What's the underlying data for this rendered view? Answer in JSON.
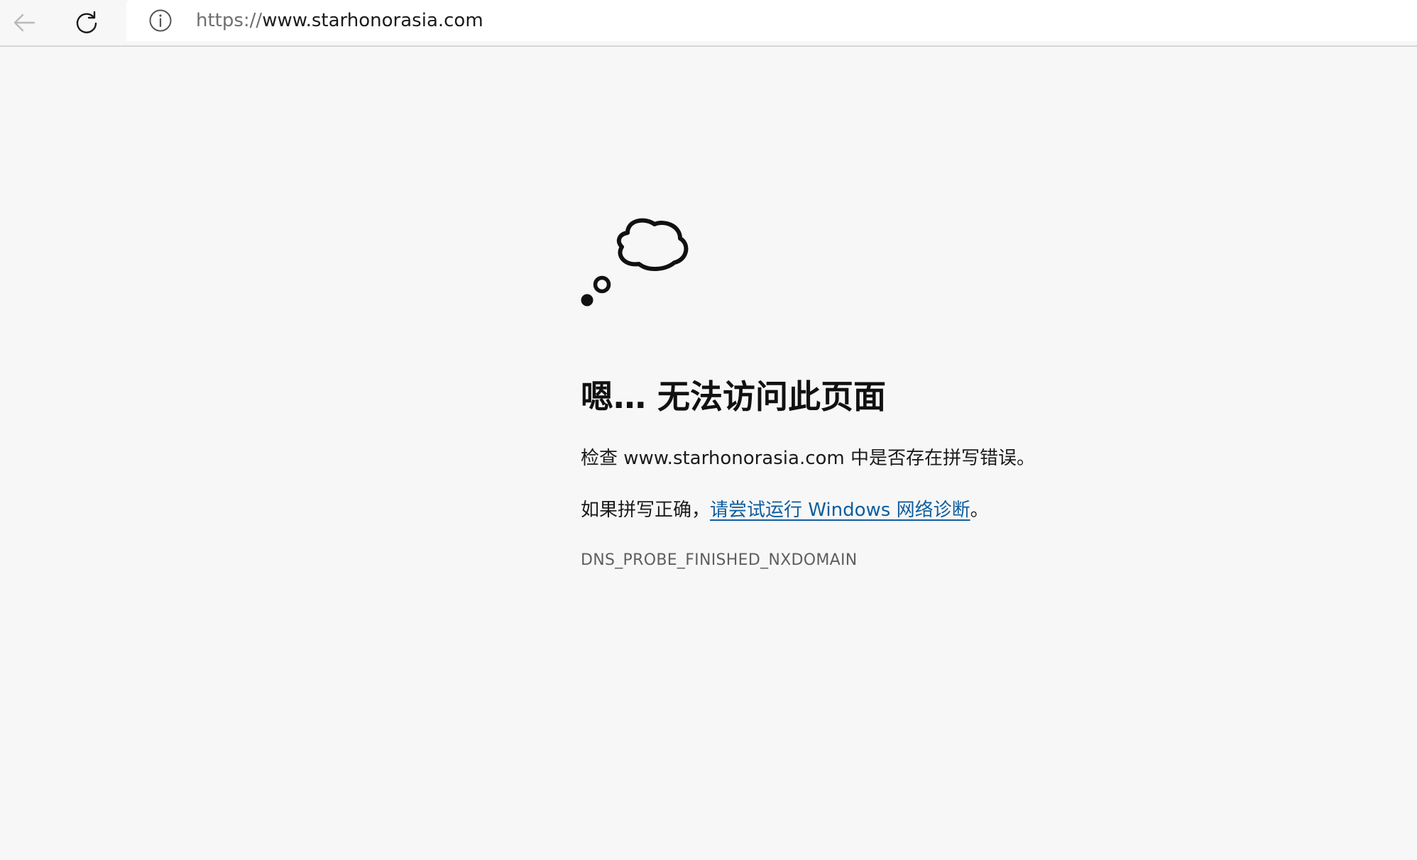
{
  "browser": {
    "back_icon": "back-arrow-icon",
    "reload_icon": "reload-icon",
    "site_info_icon": "info-icon",
    "url_scheme": "https://",
    "url_host": "www.starhonorasia.com"
  },
  "error_page": {
    "illustration_icon": "thought-cloud-icon",
    "title": "嗯… 无法访问此页面",
    "check_prefix": "检查 ",
    "check_host": "www.starhonorasia.com",
    "check_suffix": " 中是否存在拼写错误。",
    "retry_prefix": "如果拼写正确，",
    "diagnostics_link": "请尝试运行 Windows 网络诊断",
    "retry_suffix": "。",
    "error_code": "DNS_PROBE_FINISHED_NXDOMAIN"
  },
  "colors": {
    "background": "#f7f7f7",
    "link": "#0f5d9e",
    "heading": "#111111",
    "error_code": "#5f5f5f"
  }
}
